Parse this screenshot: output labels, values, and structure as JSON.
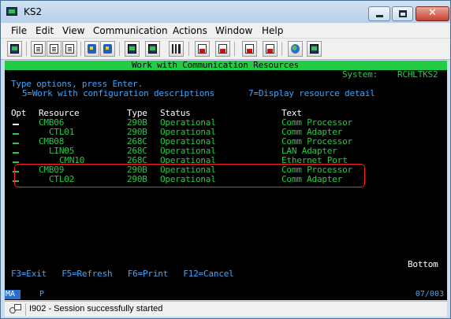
{
  "window": {
    "title": "KS2"
  },
  "menubar": [
    "File",
    "Edit",
    "View",
    "Communication",
    "Actions",
    "Window",
    "Help"
  ],
  "toolbar": {
    "buttons": [
      "copy-doc-icon",
      "paste-doc-icon",
      "clipboard-icon",
      "send-icon",
      "receive-icon",
      "display-icon",
      "keyboard-icon",
      "macro-record-icon",
      "macro-play-icon",
      "macro-stop-icon",
      "macro-edit-icon",
      "web-icon",
      "connect-icon"
    ]
  },
  "screen": {
    "heading": "Work with Communication Resources",
    "system_label": "System:",
    "system_name": "RCHLTKS2",
    "instructions": "Type options, press Enter.",
    "option_5": "5=Work with configuration descriptions",
    "option_7": "7=Display resource detail",
    "col_opt": "Opt",
    "col_resource": "Resource",
    "col_type": "Type",
    "col_status": "Status",
    "col_text": "Text",
    "rows": [
      {
        "resource": "CMB06",
        "indent": 0,
        "type": "290B",
        "status": "Operational",
        "text": "Comm Processor"
      },
      {
        "resource": "CTL01",
        "indent": 1,
        "type": "290B",
        "status": "Operational",
        "text": "Comm Adapter"
      },
      {
        "resource": "CMB08",
        "indent": 0,
        "type": "268C",
        "status": "Operational",
        "text": "Comm Processor"
      },
      {
        "resource": "LIN05",
        "indent": 1,
        "type": "268C",
        "status": "Operational",
        "text": "LAN Adapter"
      },
      {
        "resource": "CMN10",
        "indent": 2,
        "type": "268C",
        "status": "Operational",
        "text": "Ethernet Port"
      },
      {
        "resource": "CMB09",
        "indent": 0,
        "type": "290B",
        "status": "Operational",
        "text": "Comm Processor"
      },
      {
        "resource": "CTL02",
        "indent": 1,
        "type": "290B",
        "status": "Operational",
        "text": "Comm Adapter"
      }
    ],
    "bottom_label": "Bottom",
    "fkeys": "F3=Exit   F5=Refresh   F6=Print   F12=Cancel"
  },
  "operator_info": {
    "mode": "MA",
    "indicator": "P",
    "cursor_pos": "07/003"
  },
  "message_bar": {
    "text": "I902 - Session successfully started"
  },
  "colors": {
    "terminal_bg": "#000000",
    "green": "#22cc44",
    "blue": "#3ea6ff",
    "highlight": "#ff2020"
  }
}
